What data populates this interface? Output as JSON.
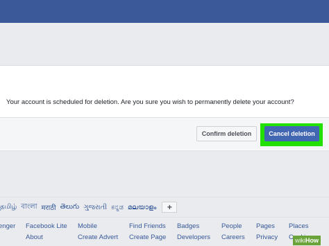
{
  "dialog": {
    "message": "Your account is scheduled for deletion. Are you sure you wish to permanently delete your account?",
    "confirm_label": "Confirm deletion",
    "cancel_label": "Cancel deletion"
  },
  "languages": [
    "தமிழ்",
    "বাংলা",
    "मराठी",
    "తెలుగు",
    "ગુજરાતી",
    "ಕನ್ನಡ",
    "മലയാളം"
  ],
  "add_language_label": "+",
  "footer_links": {
    "row1": [
      "enger",
      "Facebook Lite",
      "Mobile",
      "Find Friends",
      "Badges",
      "People",
      "Pages",
      "Places"
    ],
    "row2": [
      "",
      "About",
      "Create Advert",
      "Create Page",
      "Developers",
      "Careers",
      "Privacy",
      "Cookie"
    ]
  },
  "watermark": {
    "part1": "wiki",
    "part2": "How"
  },
  "colors": {
    "brand_blue": "#3b5998",
    "button_blue": "#4267b2",
    "highlight_green": "#22e000",
    "link_blue": "#365899"
  }
}
